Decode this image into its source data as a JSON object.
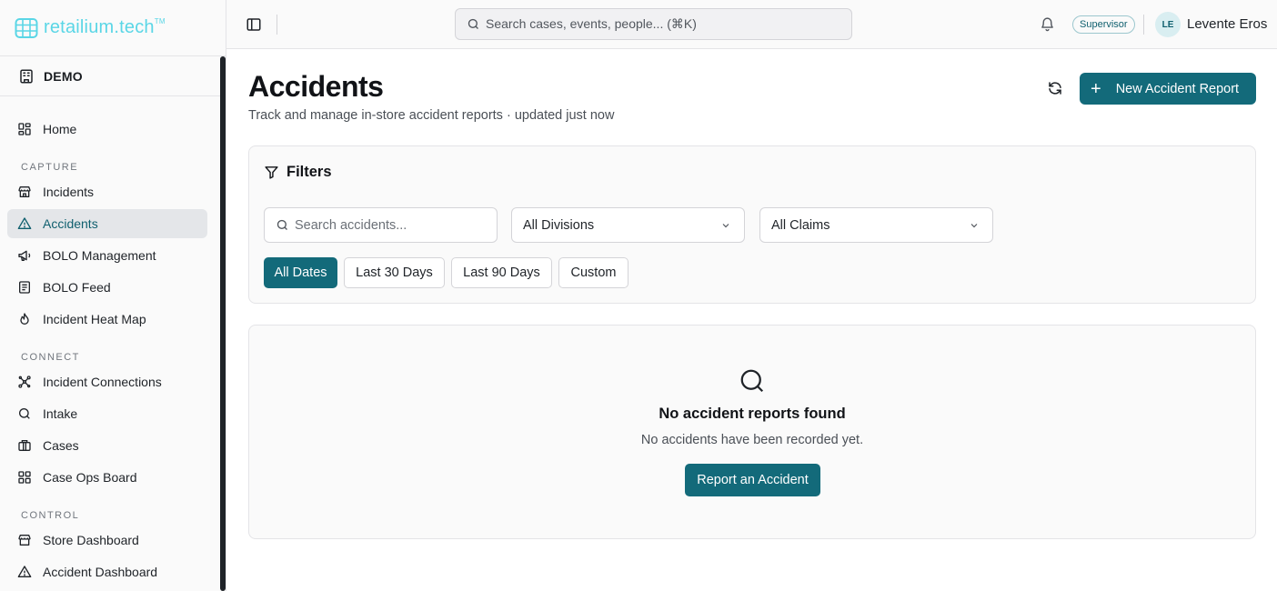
{
  "brand": {
    "name": "retailium.tech",
    "trademark": "TM",
    "color": "#5ad6e6"
  },
  "org": {
    "label": "DEMO"
  },
  "sidebar": {
    "home": {
      "label": "Home",
      "icon": "grid-icon"
    },
    "sections": [
      {
        "label": "CAPTURE",
        "items": [
          {
            "label": "Incidents",
            "icon": "store-icon"
          },
          {
            "label": "Accidents",
            "icon": "warning-triangle-icon",
            "active": true
          },
          {
            "label": "BOLO Management",
            "icon": "megaphone-icon"
          },
          {
            "label": "BOLO Feed",
            "icon": "feed-icon"
          },
          {
            "label": "Incident Heat Map",
            "icon": "flame-icon"
          }
        ]
      },
      {
        "label": "CONNECT",
        "items": [
          {
            "label": "Incident Connections",
            "icon": "network-icon"
          },
          {
            "label": "Intake",
            "icon": "search-icon"
          },
          {
            "label": "Cases",
            "icon": "briefcase-icon"
          },
          {
            "label": "Case Ops Board",
            "icon": "grid-icon"
          }
        ]
      },
      {
        "label": "CONTROL",
        "items": [
          {
            "label": "Store Dashboard",
            "icon": "store-icon"
          },
          {
            "label": "Accident Dashboard",
            "icon": "warning-triangle-icon"
          }
        ]
      }
    ]
  },
  "header": {
    "search_placeholder": "Search cases, events, people... (⌘K)",
    "role": "Supervisor",
    "avatar_initials": "LE",
    "user_name": "Levente Eros"
  },
  "page": {
    "title": "Accidents",
    "subtitle": "Track and manage in-store accident reports · updated just now",
    "new_button": "New Accident Report"
  },
  "filters": {
    "title": "Filters",
    "search_placeholder": "Search accidents...",
    "division_value": "All Divisions",
    "claims_value": "All Claims",
    "date_chips": [
      "All Dates",
      "Last 30 Days",
      "Last 90 Days",
      "Custom"
    ],
    "active_chip": "All Dates"
  },
  "empty_state": {
    "title": "No accident reports found",
    "subtitle": "No accidents have been recorded yet.",
    "button": "Report an Accident"
  },
  "colors": {
    "accent": "#136a7a",
    "active_nav_bg": "#e4e6e9"
  }
}
